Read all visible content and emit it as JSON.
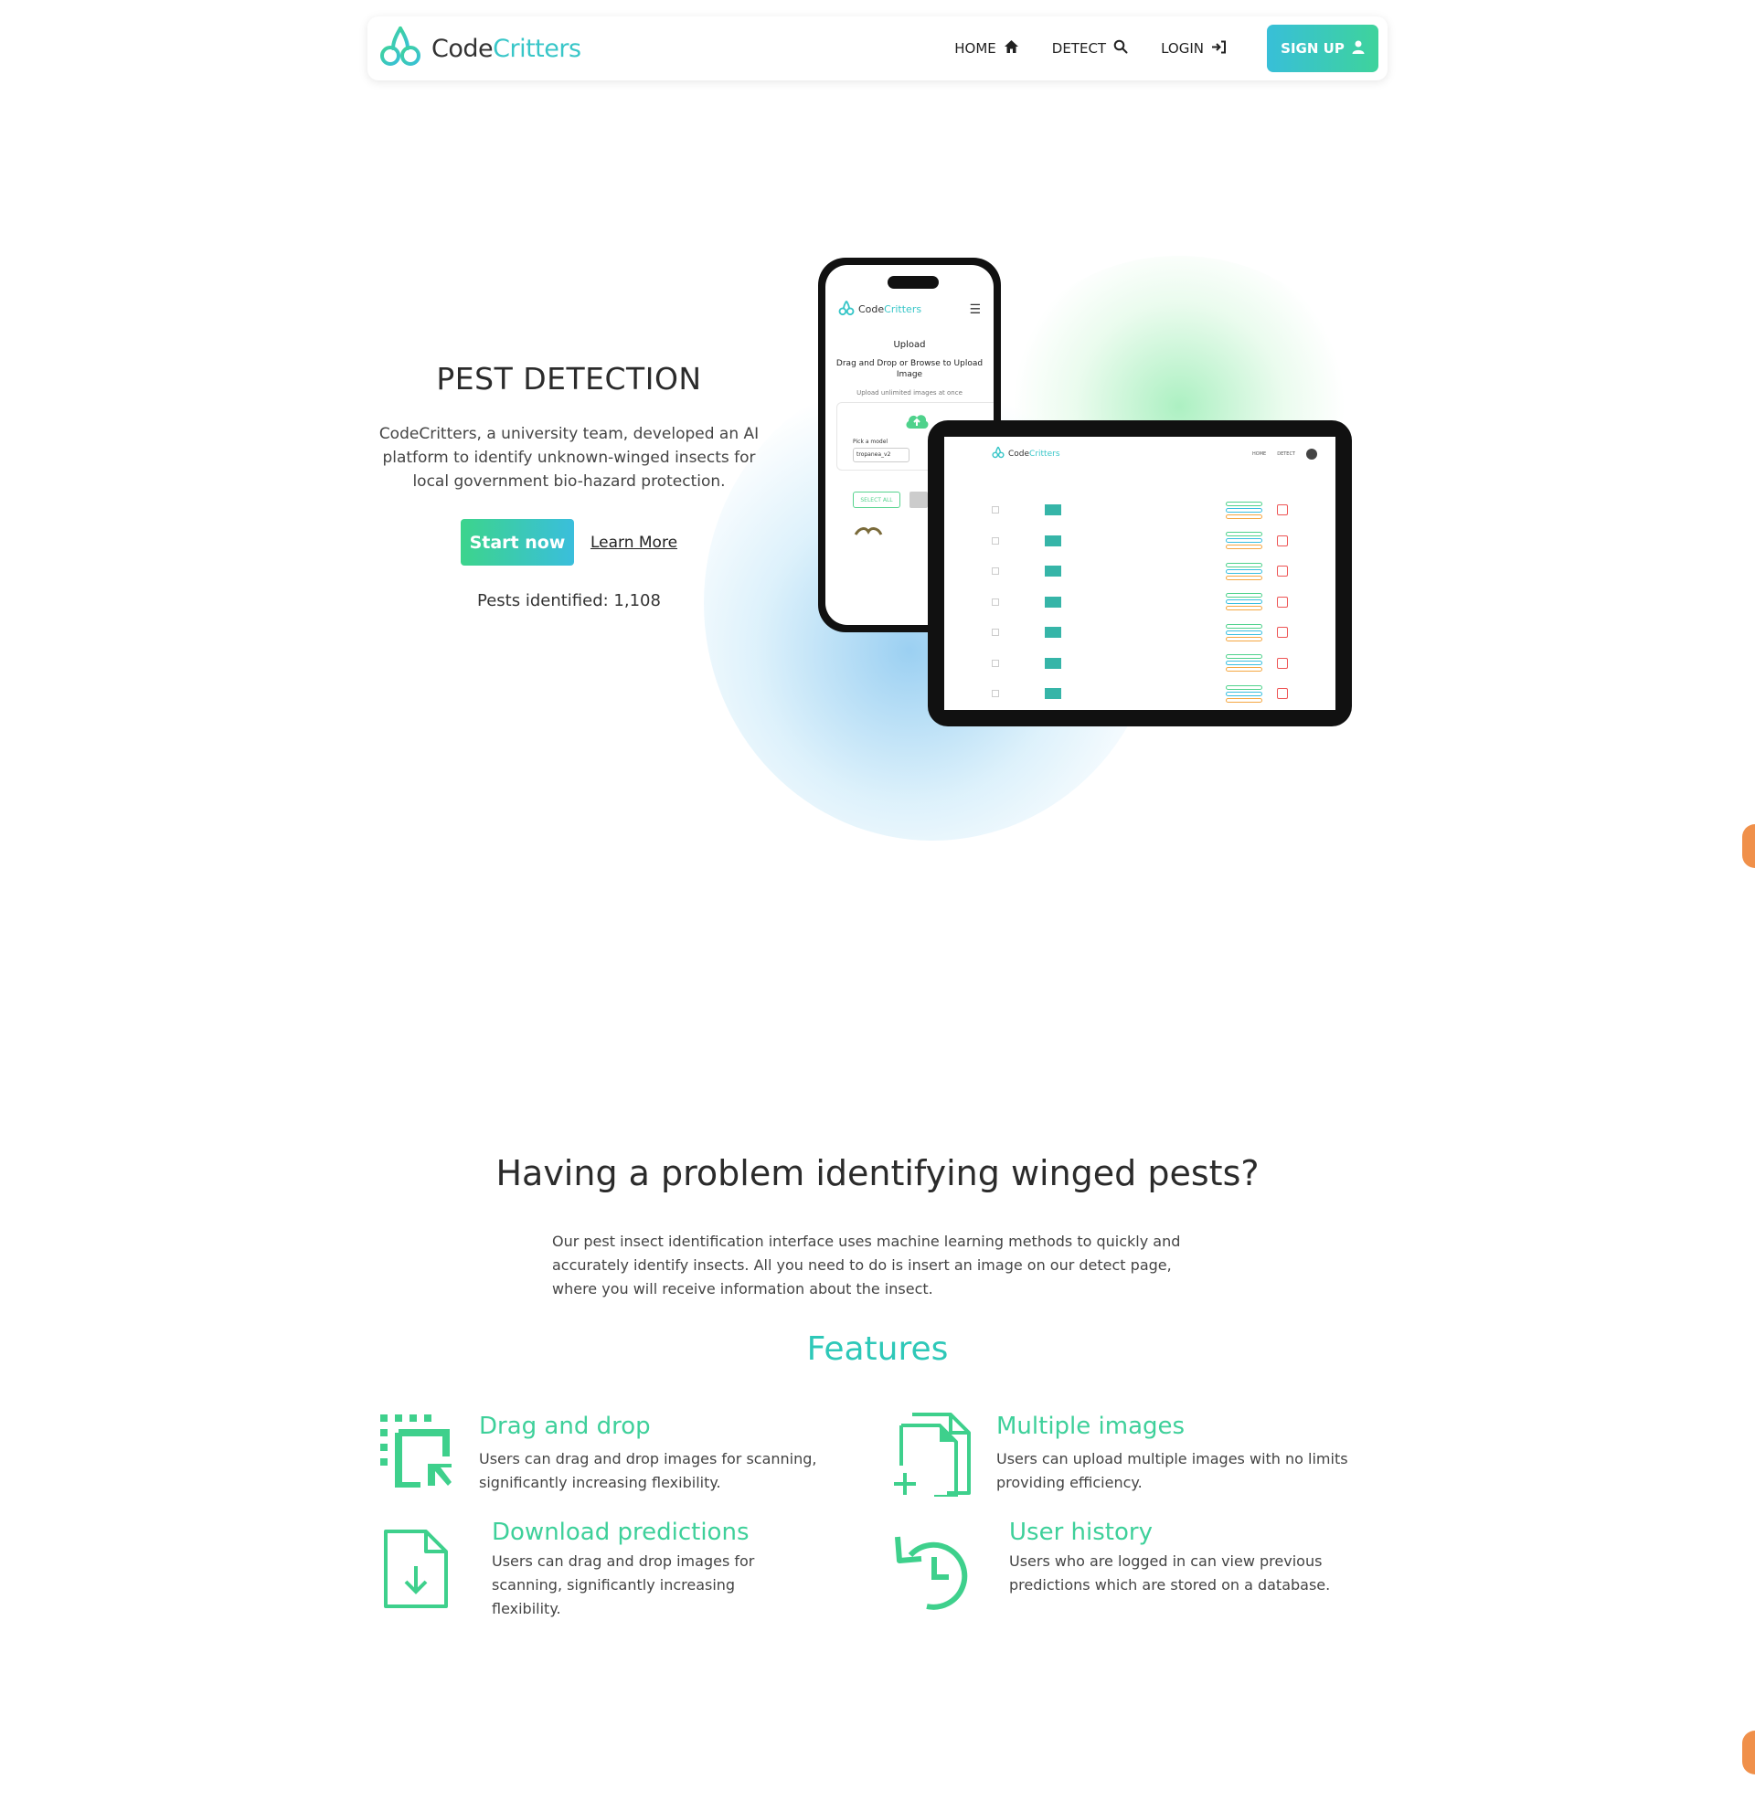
{
  "brand": {
    "part1": "Code",
    "part2": "Critters"
  },
  "nav": {
    "home": "HOME",
    "detect": "DETECT",
    "login": "LOGIN",
    "signup": "SIGN UP"
  },
  "hero": {
    "title": "PEST DETECTION",
    "description": "CodeCritters, a university team, developed an AI platform to identify unknown-winged insects for local government bio-hazard protection.",
    "start_label": "Start now",
    "learn_label": "Learn More",
    "pests_identified": "Pests identified: 1,108"
  },
  "phone": {
    "brand1": "Code",
    "brand2": "Critters",
    "upload": "Upload",
    "drag_text": "Drag and Drop or Browse to Upload Image",
    "unlimited": "Upload unlimited images at once",
    "pick_model": "Pick a model",
    "model_value": "tropanea_v2",
    "select_all": "SELECT ALL"
  },
  "tablet": {
    "brand1": "Code",
    "brand2": "Critters",
    "nav_home": "HOME",
    "nav_detect": "DETECT"
  },
  "problem": {
    "title": "Having a problem identifying winged pests?",
    "description": "Our pest insect identification interface uses machine learning methods to quickly and accurately identify insects. All you need to do is insert an image on our detect page, where you will receive information about the insect."
  },
  "features": {
    "title": "Features",
    "items": [
      {
        "title": "Drag and drop",
        "text": "Users can drag and drop images for scanning, significantly increasing flexibility.",
        "icon": "drag-drop-icon"
      },
      {
        "title": "Multiple images",
        "text": "Users can upload multiple images with no limits providing efficiency.",
        "icon": "multiple-files-icon"
      },
      {
        "title": "Download predictions",
        "text": "Users can drag and drop images for scanning, significantly increasing flexibility.",
        "icon": "file-download-icon"
      },
      {
        "title": "User history",
        "text": "Users who are logged in can view previous predictions which are stored on a database.",
        "icon": "history-icon"
      }
    ]
  },
  "colors": {
    "accent_teal": "#38c6c8",
    "accent_green": "#3ed09a",
    "orange": "#f0904a"
  }
}
